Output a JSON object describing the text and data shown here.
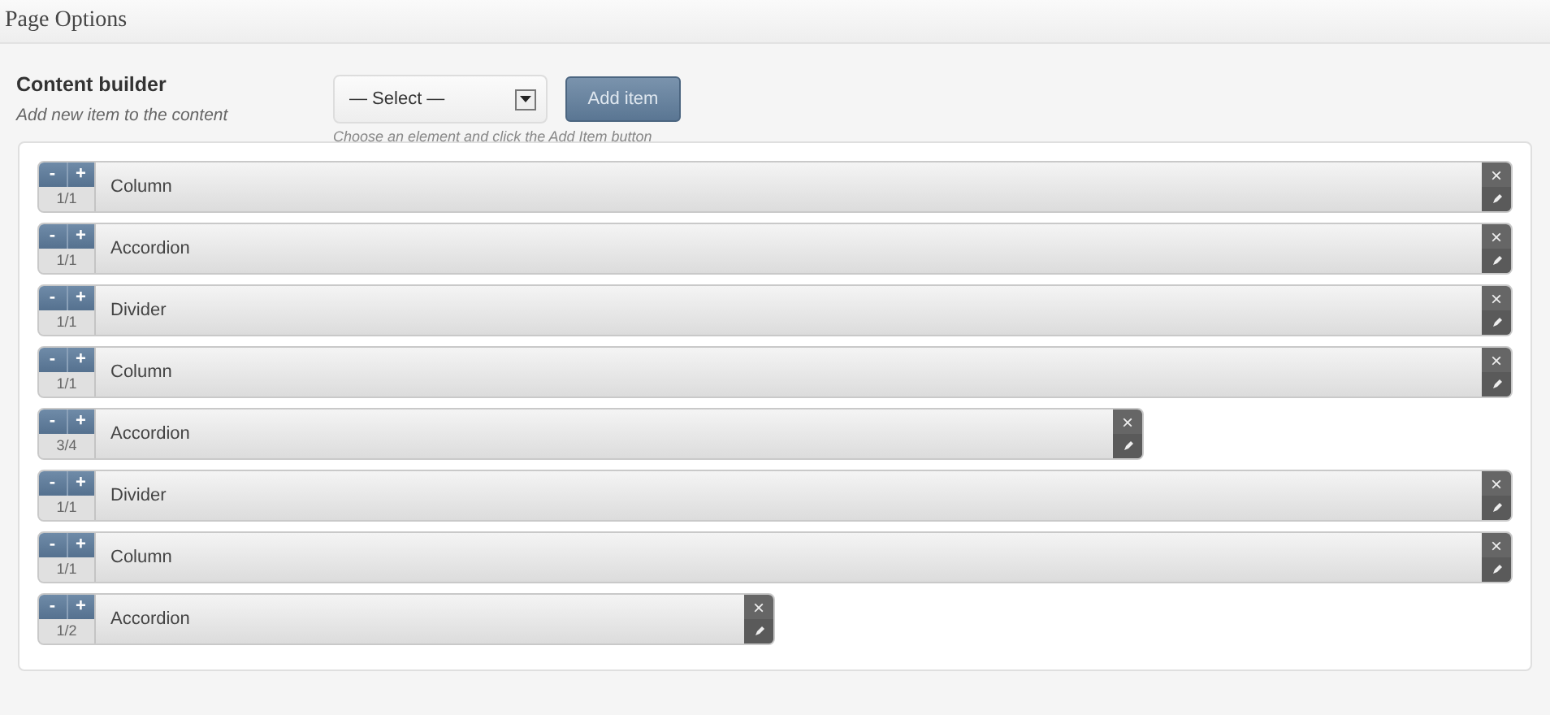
{
  "header": {
    "title": "Page Options"
  },
  "builder": {
    "title": "Content builder",
    "description": "Add new item to the content",
    "select": {
      "value": "— Select —"
    },
    "add_button": "Add item",
    "hint": "Choose an element and click the Add Item button"
  },
  "items": [
    {
      "minus": "-",
      "plus": "+",
      "size": "1/1",
      "label": "Column",
      "remove": "×"
    },
    {
      "minus": "-",
      "plus": "+",
      "size": "1/1",
      "label": "Accordion",
      "remove": "×"
    },
    {
      "minus": "-",
      "plus": "+",
      "size": "1/1",
      "label": "Divider",
      "remove": "×"
    },
    {
      "minus": "-",
      "plus": "+",
      "size": "1/1",
      "label": "Column",
      "remove": "×"
    },
    {
      "minus": "-",
      "plus": "+",
      "size": "3/4",
      "label": "Accordion",
      "remove": "×"
    },
    {
      "minus": "-",
      "plus": "+",
      "size": "1/1",
      "label": "Divider",
      "remove": "×"
    },
    {
      "minus": "-",
      "plus": "+",
      "size": "1/1",
      "label": "Column",
      "remove": "×"
    },
    {
      "minus": "-",
      "plus": "+",
      "size": "1/2",
      "label": "Accordion",
      "remove": "×"
    }
  ]
}
